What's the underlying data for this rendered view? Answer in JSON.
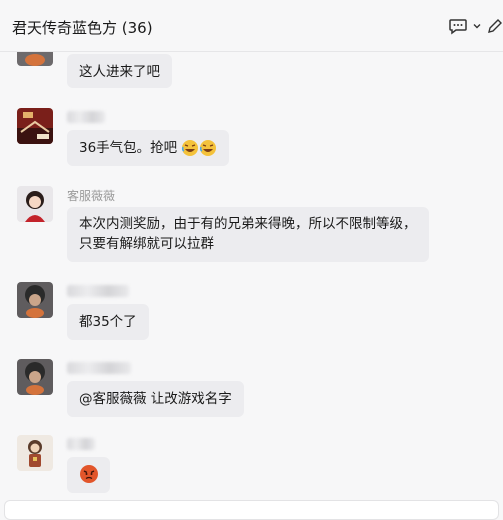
{
  "header": {
    "title": "君天传奇蓝色方 (36)"
  },
  "messages": [
    {
      "text": "这人进来了吧"
    },
    {
      "text": "36手气包。抢吧"
    },
    {
      "sender": "客服薇薇",
      "lines": [
        "本次内测奖励，由于有的兄弟来得晚，所以不限制等级，",
        "只要有解绑就可以拉群"
      ]
    },
    {
      "text": "都35个了"
    },
    {
      "text": "@客服薇薇 让改游戏名字"
    }
  ],
  "colors": {
    "bubble": "#ececef",
    "background": "#f7f7f8",
    "sender_name": "#9a9a9a"
  }
}
